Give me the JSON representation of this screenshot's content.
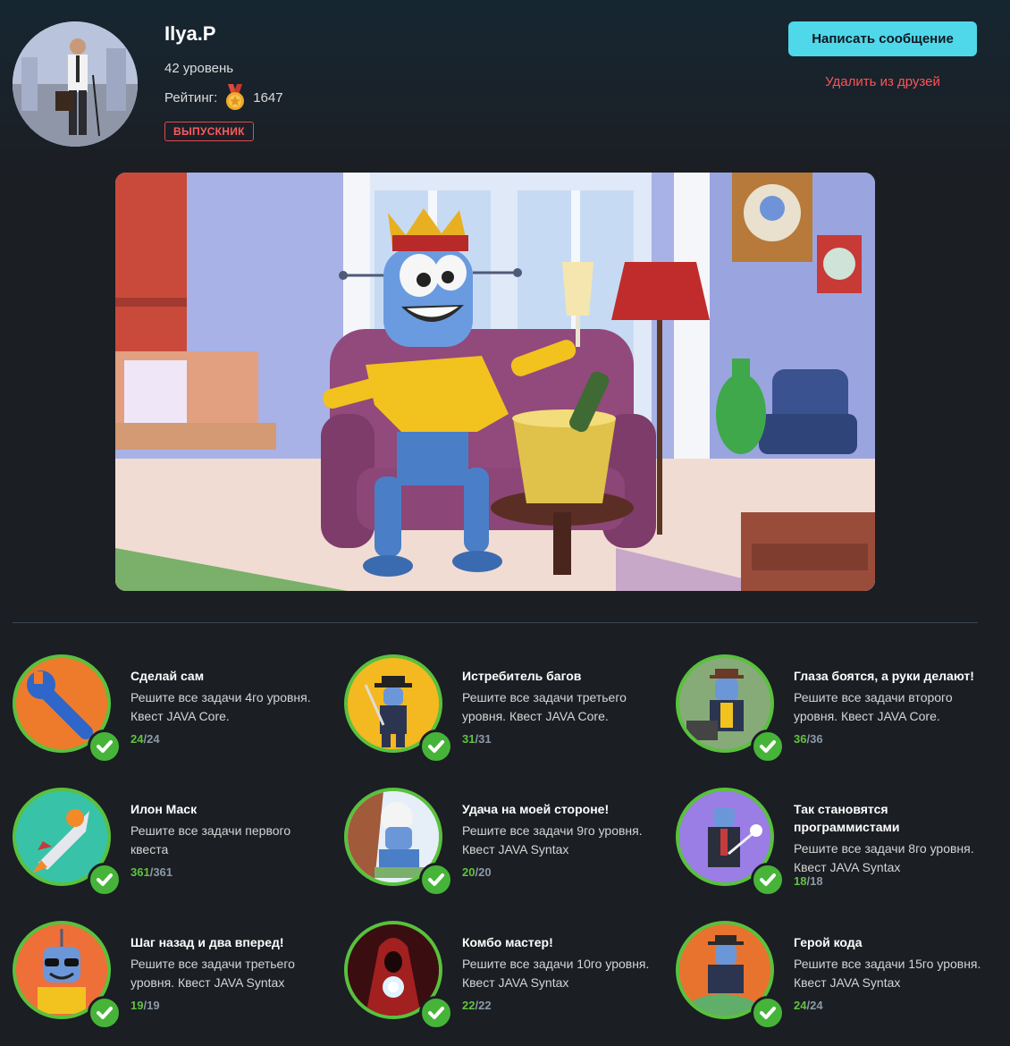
{
  "profile": {
    "name": "Ilya.P",
    "level": "42 уровень",
    "rating_label": "Рейтинг:",
    "rating_value": "1647",
    "badge": "ВЫПУСКНИК"
  },
  "actions": {
    "message": "Написать сообщение",
    "unfriend": "Удалить из друзей"
  },
  "colors": {
    "accent": "#4fd8ea",
    "danger": "#ff5257",
    "success": "#59c13d",
    "background": "#1b1e23"
  },
  "achievements": [
    {
      "title": "Сделай сам",
      "desc": "Решите все задачи 4го уровня. Квест JAVA Core.",
      "done": "24",
      "sep": "/",
      "total": "24",
      "icon": "wrench-icon"
    },
    {
      "title": "Истребитель багов",
      "desc": "Решите все задачи третьего уровня. Квест JAVA Core.",
      "done": "31",
      "sep": "/",
      "total": "31",
      "icon": "bug-hunter-robot-icon"
    },
    {
      "title": "Глаза боятся, а руки делают!",
      "desc": "Решите все задачи второго уровня. Квест JAVA Core.",
      "done": "36",
      "sep": "/",
      "total": "36",
      "icon": "typing-robot-icon"
    },
    {
      "title": "Илон Маск",
      "desc": "Решите все задачи первого квеста",
      "done": "361",
      "sep": "/",
      "total": "361",
      "icon": "rocket-icon"
    },
    {
      "title": "Удача на моей стороне!",
      "desc": "Решите все задачи 9го уровня. Квест JAVA Syntax",
      "done": "20",
      "sep": "/",
      "total": "20",
      "icon": "lucky-robot-icon"
    },
    {
      "title": "Так становятся программистами",
      "desc": "Решите все задачи 8го уровня. Квест JAVA Syntax",
      "done": "18",
      "sep": "/",
      "total": "18",
      "icon": "wizard-robot-icon"
    },
    {
      "title": "Шаг назад и два вперед!",
      "desc": "Решите все задачи третьего уровня. Квест JAVA Syntax",
      "done": "19",
      "sep": "/",
      "total": "19",
      "icon": "sunglasses-robot-icon"
    },
    {
      "title": "Комбо мастер!",
      "desc": "Решите все задачи 10го уровня. Квест JAVA Syntax",
      "done": "22",
      "sep": "/",
      "total": "22",
      "icon": "hooded-mage-icon"
    },
    {
      "title": "Герой кода",
      "desc": "Решите все задачи 15го уровня. Квест JAVA Syntax",
      "done": "24",
      "sep": "/",
      "total": "24",
      "icon": "code-hero-icon"
    }
  ]
}
